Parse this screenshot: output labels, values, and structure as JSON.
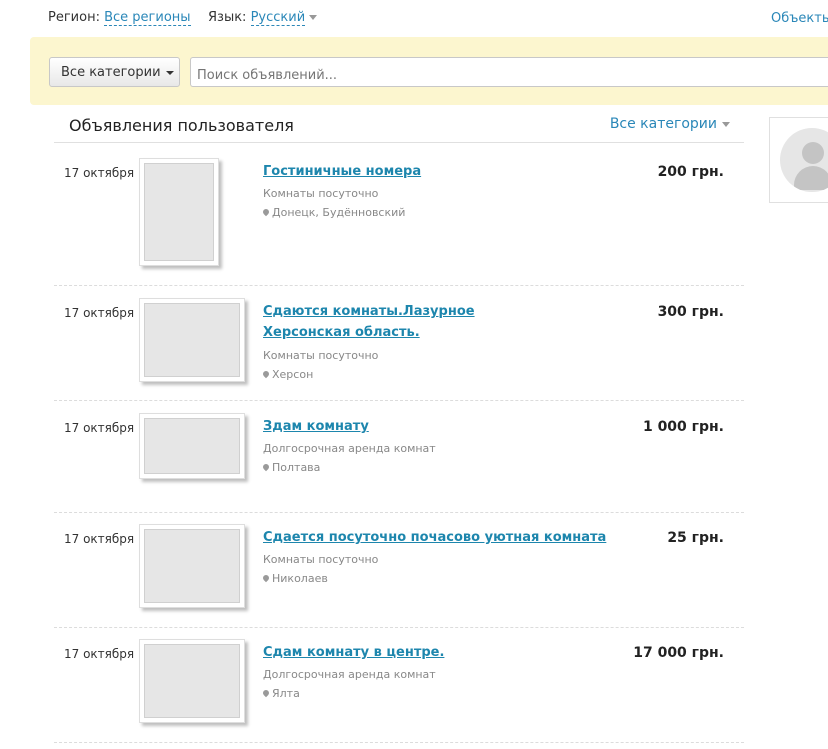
{
  "topbar": {
    "region_label": "Регион:",
    "region_value": "Все регионы",
    "language_label": "Язык:",
    "language_value": "Русский",
    "right_link": "Объекть"
  },
  "search": {
    "category_button": "Все категории",
    "placeholder": "Поиск объявлений..."
  },
  "section": {
    "title": "Объявления пользователя",
    "filter": "Все категории"
  },
  "listings": [
    {
      "date": "17 октября",
      "title": "Гостиничные номера",
      "category": "Комнаты посуточно",
      "city": "Донецк, Будённовский",
      "price": "200 грн.",
      "image": "hotel-room-photo"
    },
    {
      "date": "17 октября",
      "title": "Сдаются комнаты.Лазурное Херсонская область.",
      "category": "Комнаты посуточно",
      "city": "Херсон",
      "price": "300 грн.",
      "image": "house-photo"
    },
    {
      "date": "17 октября",
      "title": "Здам комнату",
      "category": "Долгосрочная аренда комнат",
      "city": "Полтава",
      "price": "1 000 грн.",
      "image": "room-photo"
    },
    {
      "date": "17 октября",
      "title": "Сдается посуточно почасово уютная комната",
      "category": "Комнаты посуточно",
      "city": "Николаев",
      "price": "25 грн.",
      "image": "bedroom-photo"
    },
    {
      "date": "17 октября",
      "title": "Сдам комнату в центре.",
      "category": "Долгосрочная аренда комнат",
      "city": "Ялта",
      "price": "17 000 грн.",
      "image": "room-tv-photo"
    }
  ],
  "colors": {
    "link": "#2a87b8",
    "search_bg": "#fcf6cf"
  }
}
